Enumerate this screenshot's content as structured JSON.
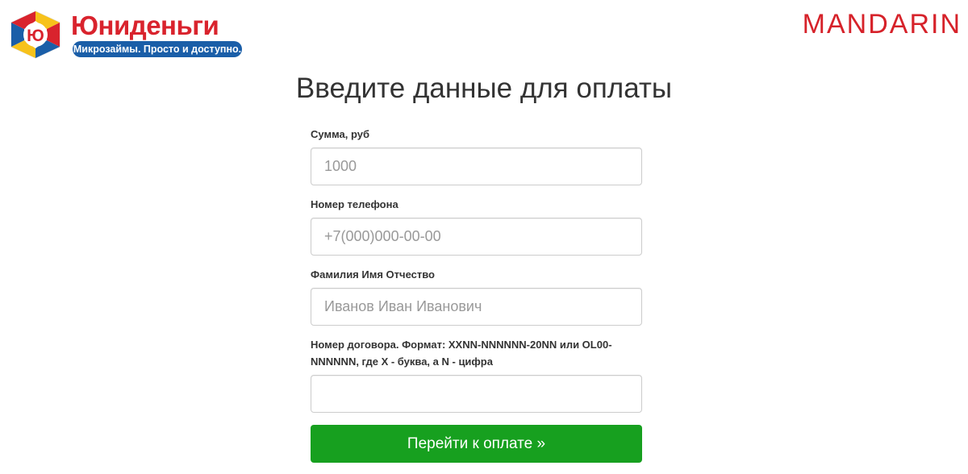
{
  "header": {
    "brand_mark": "Ю",
    "brand_name": "Юниденьги",
    "brand_tagline": "Микрозаймы. Просто и доступно.",
    "partner_logo": "MANDARIN"
  },
  "title": "Введите данные для оплаты",
  "form": {
    "amount": {
      "label": "Сумма, руб",
      "placeholder": "1000",
      "value": ""
    },
    "phone": {
      "label": "Номер телефона",
      "placeholder": "+7(000)000-00-00",
      "value": ""
    },
    "full_name": {
      "label": "Фамилия Имя Отчество",
      "placeholder": "Иванов Иван Иванович",
      "value": ""
    },
    "contract": {
      "label": "Номер договора. Формат: XXNN-NNNNNN-20NN или OL00-NNNNNN, где X - буква, а N - цифра",
      "placeholder": "",
      "value": ""
    },
    "submit_label": "Перейти к оплате »"
  },
  "colors": {
    "brand_red": "#d9232d",
    "brand_blue": "#1a5ea8",
    "brand_yellow": "#f7c21b",
    "partner_red": "#d6222a",
    "submit_green": "#17a01f"
  }
}
